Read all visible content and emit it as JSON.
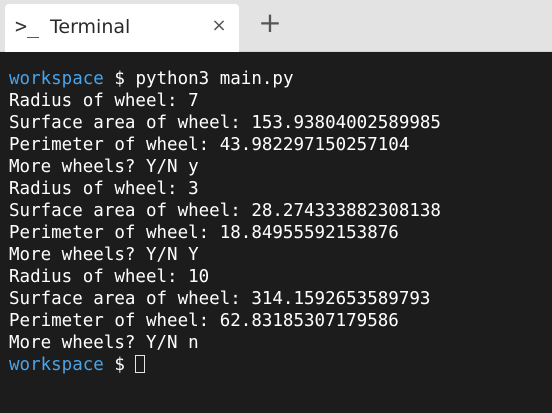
{
  "tab": {
    "icon": "terminal-prompt-icon",
    "icon_glyph": ">_",
    "title": "Terminal",
    "close_glyph": "×",
    "new_tab_glyph": "+"
  },
  "terminal": {
    "prompt_user": "workspace",
    "prompt_symbol": " $ ",
    "lines": [
      {
        "type": "prompt",
        "command": "python3 main.py"
      },
      {
        "type": "output",
        "text": "Radius of wheel: 7"
      },
      {
        "type": "output",
        "text": "Surface area of wheel: 153.93804002589985"
      },
      {
        "type": "output",
        "text": "Perimeter of wheel: 43.982297150257104"
      },
      {
        "type": "output",
        "text": "More wheels? Y/N y"
      },
      {
        "type": "output",
        "text": "Radius of wheel: 3"
      },
      {
        "type": "output",
        "text": "Surface area of wheel: 28.274333882308138"
      },
      {
        "type": "output",
        "text": "Perimeter of wheel: 18.84955592153876"
      },
      {
        "type": "output",
        "text": "More wheels? Y/N Y"
      },
      {
        "type": "output",
        "text": "Radius of wheel: 10"
      },
      {
        "type": "output",
        "text": "Surface area of wheel: 314.1592653589793"
      },
      {
        "type": "output",
        "text": "Perimeter of wheel: 62.83185307179586"
      },
      {
        "type": "output",
        "text": "More wheels? Y/N n"
      },
      {
        "type": "prompt",
        "command": "",
        "cursor": true
      }
    ]
  },
  "colors": {
    "background": "#1c1c1c",
    "prompt_user": "#4aa3e8",
    "text": "#ffffff",
    "tabbar": "#e3e3e3"
  }
}
